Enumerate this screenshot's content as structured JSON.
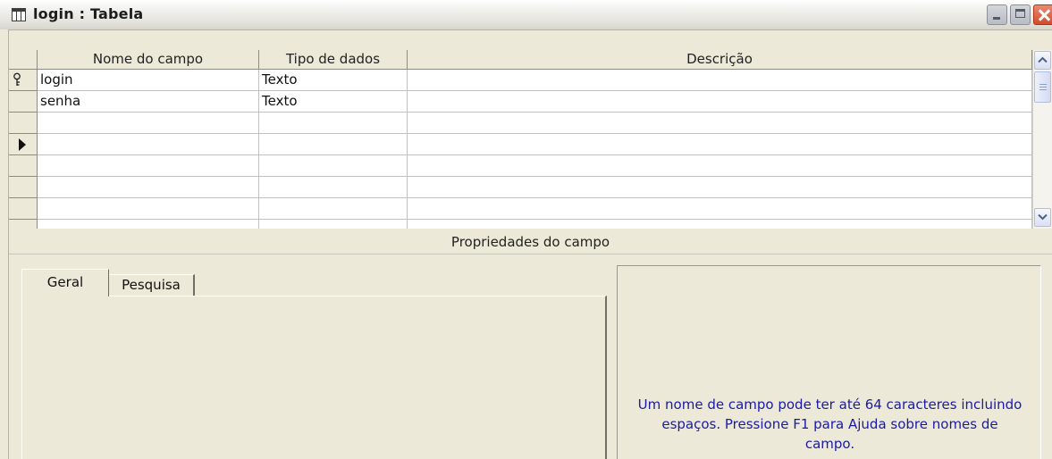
{
  "window": {
    "title": "login : Tabela",
    "icons": {
      "title": "table-icon",
      "minimize": "minimize-icon",
      "maximize": "maximize-icon",
      "close": "close-icon"
    }
  },
  "grid": {
    "headers": {
      "field_name": "Nome do campo",
      "data_type": "Tipo de dados",
      "description": "Descrição"
    },
    "rows": [
      {
        "field_name": "login",
        "data_type": "Texto",
        "description": "",
        "primary_key": true
      },
      {
        "field_name": "senha",
        "data_type": "Texto",
        "description": ""
      },
      {
        "field_name": "",
        "data_type": "",
        "description": ""
      },
      {
        "field_name": "",
        "data_type": "",
        "description": "",
        "current_record": true
      },
      {
        "field_name": "",
        "data_type": "",
        "description": ""
      },
      {
        "field_name": "",
        "data_type": "",
        "description": ""
      },
      {
        "field_name": "",
        "data_type": "",
        "description": ""
      },
      {
        "field_name": "",
        "data_type": "",
        "description": ""
      }
    ]
  },
  "properties": {
    "title": "Propriedades do campo",
    "tabs": [
      "Geral",
      "Pesquisa"
    ],
    "active_tab": "Geral",
    "help_text": "Um nome de campo pode ter até 64 caracteres incluindo espaços. Pressione F1 para Ajuda sobre nomes de campo."
  },
  "colors": {
    "help_text": "#1a1aa6",
    "chrome": "#ece9d8",
    "close_button": "#d24b2c"
  }
}
